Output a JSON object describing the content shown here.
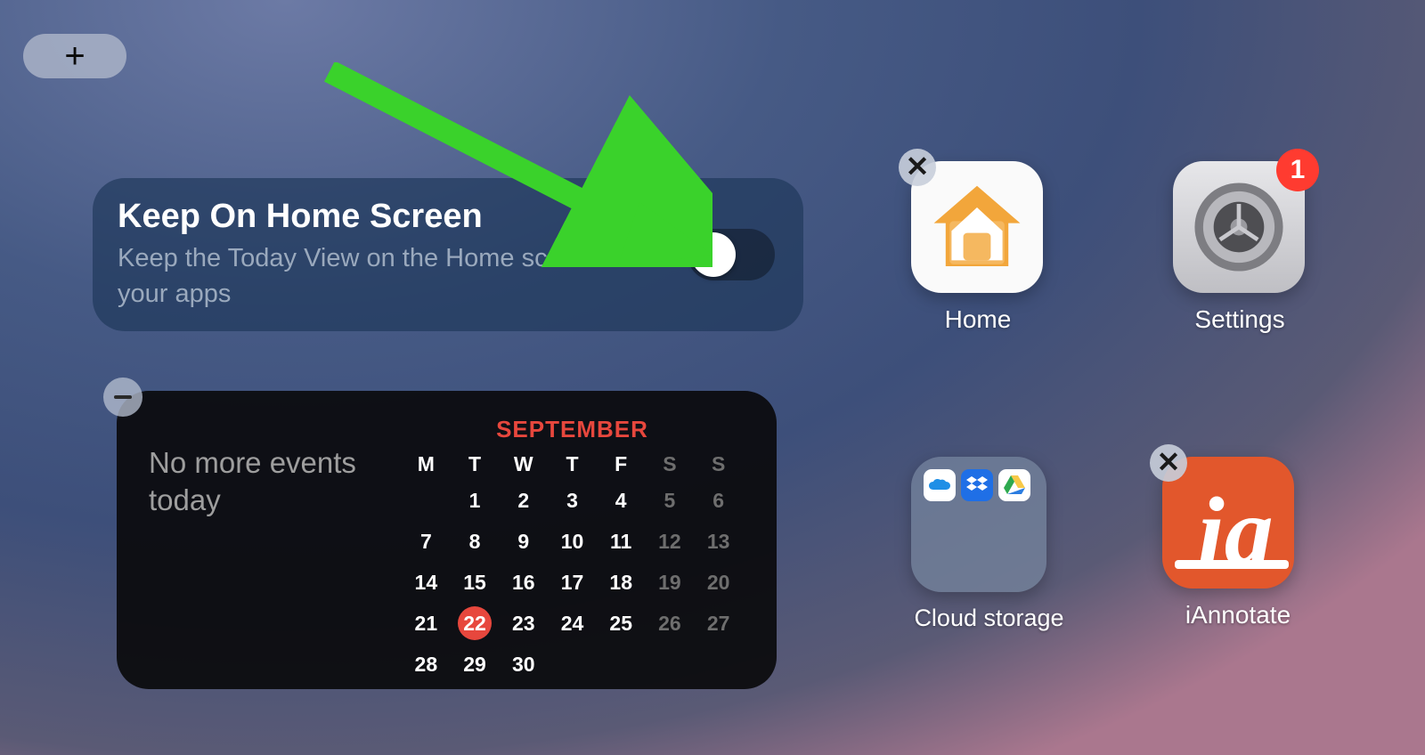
{
  "add_button": {},
  "keep_card": {
    "title": "Keep On Home Screen",
    "subtitle": "Keep the Today View on the Home screen next to your apps",
    "toggle_on": false
  },
  "calendar": {
    "month": "SEPTEMBER",
    "no_events_msg": "No more events today",
    "today": 22,
    "week_start": "M",
    "headers": [
      "M",
      "T",
      "W",
      "T",
      "F",
      "S",
      "S"
    ],
    "first_day_offset": 1,
    "days_in_month": 30
  },
  "apps": {
    "home": {
      "label": "Home"
    },
    "settings": {
      "label": "Settings",
      "badge": "1"
    },
    "cloud": {
      "label": "Cloud storage"
    },
    "iannotate": {
      "label": "iAnnotate"
    }
  },
  "annotation_arrow": {
    "color": "#3ad22b"
  }
}
